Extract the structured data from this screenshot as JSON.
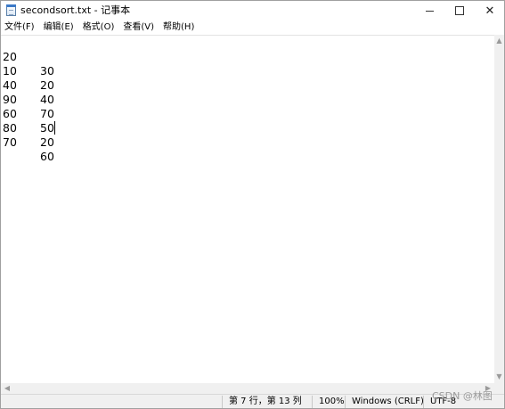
{
  "window": {
    "title": "secondsort.txt - 记事本",
    "controls": {
      "minimize_icon": "minimize-icon",
      "maximize_icon": "maximize-icon",
      "close_symbol": "✕"
    }
  },
  "menu": {
    "items": [
      "文件(F)",
      "编辑(E)",
      "格式(O)",
      "查看(V)",
      "帮助(H)"
    ]
  },
  "editor": {
    "lines": [
      {
        "a": "20",
        "b": "30"
      },
      {
        "a": "10",
        "b": "20"
      },
      {
        "a": "40",
        "b": "40"
      },
      {
        "a": "90",
        "b": "70"
      },
      {
        "a": "60",
        "b": "50"
      },
      {
        "a": "80",
        "b": "20"
      },
      {
        "a": "70",
        "b": "60"
      }
    ]
  },
  "scrollbars": {
    "up_arrow": "▲",
    "down_arrow": "▼",
    "left_arrow": "◀",
    "right_arrow": "▶"
  },
  "status": {
    "position": "第 7 行，第 13 列",
    "zoom": "100%",
    "line_ending": "Windows (CRLF)",
    "encoding": "UTF-8"
  },
  "watermark": "CSDN @林图"
}
